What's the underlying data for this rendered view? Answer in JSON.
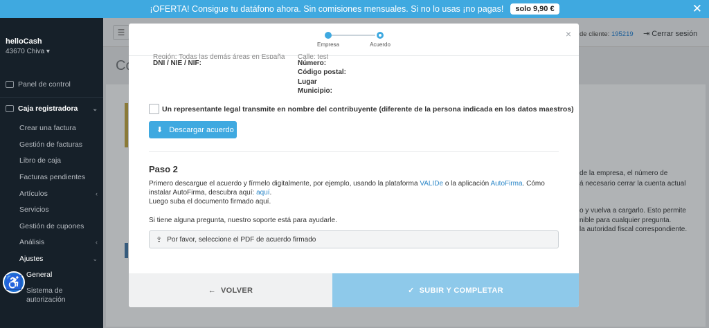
{
  "promo": {
    "text": "¡OFERTA! Consigue tu datáfono ahora. Sin comisiones mensuales. Si no lo usas ¡no pagas!",
    "price": "solo 9,90 €",
    "close": "✕"
  },
  "sidebar": {
    "brand": "helloCash",
    "location": "43670 Chiva ▾",
    "items": [
      {
        "label": "Panel de control"
      },
      {
        "label": "Caja registradora"
      },
      {
        "label": "Crear una factura"
      },
      {
        "label": "Gestión de facturas"
      },
      {
        "label": "Libro de caja"
      },
      {
        "label": "Facturas pendientes"
      },
      {
        "label": "Artículos"
      },
      {
        "label": "Servicios"
      },
      {
        "label": "Gestión de cupones"
      },
      {
        "label": "Análisis"
      },
      {
        "label": "Ajustes"
      },
      {
        "label": "General"
      },
      {
        "label": "Sistema de autorización"
      }
    ]
  },
  "topbar": {
    "client_label": "de cliente:",
    "client_number": "195219",
    "logout": "Cerrar sesión",
    "page_title": "Co"
  },
  "background_text": {
    "line1": "de la empresa, el número de",
    "line2": "á necesario cerrar la cuenta actual",
    "line3": "o y vuelva a cargarlo. Esto permite",
    "line4": "nible para cualquier pregunta.",
    "line5": "la autoridad fiscal correspondiente."
  },
  "modal": {
    "close": "×",
    "steps": [
      {
        "label": "Empresa"
      },
      {
        "label": "Acuerdo"
      }
    ],
    "fields_left": {
      "cut": "Región: Todas las demás áreas en España",
      "dni": "DNI / NIE / NIF:"
    },
    "fields_right": {
      "cut": "Calle: test",
      "numero": "Número:",
      "cp": "Código postal:",
      "lugar": "Lugar",
      "municipio": "Municipio:"
    },
    "checkbox_label": "Un representante legal transmite en nombre del contribuyente (diferente de la persona indicada en los datos maestros)",
    "download_button": "Descargar acuerdo",
    "step2_heading": "Paso 2",
    "step2_text_a": "Primero descargue el acuerdo y fírmelo digitalmente, por ejemplo, usando la plataforma ",
    "link_valide": "VALIDe",
    "step2_text_b": " o la aplicación ",
    "link_autofirma": "AutoFirma",
    "step2_text_c": ". Cómo",
    "step2_line2": "instalar AutoFirma, descubra aquí: ",
    "link_aqui": "aquí",
    "step2_line2_end": ".",
    "step2_line3": "Luego suba el documento firmado aquí.",
    "support_text": "Si tiene alguna pregunta, nuestro soporte está para ayudarle.",
    "file_placeholder": "Por favor, seleccione el PDF de acuerdo firmado",
    "back_button": "VOLVER",
    "submit_button": "SUBIR Y COMPLETAR"
  }
}
